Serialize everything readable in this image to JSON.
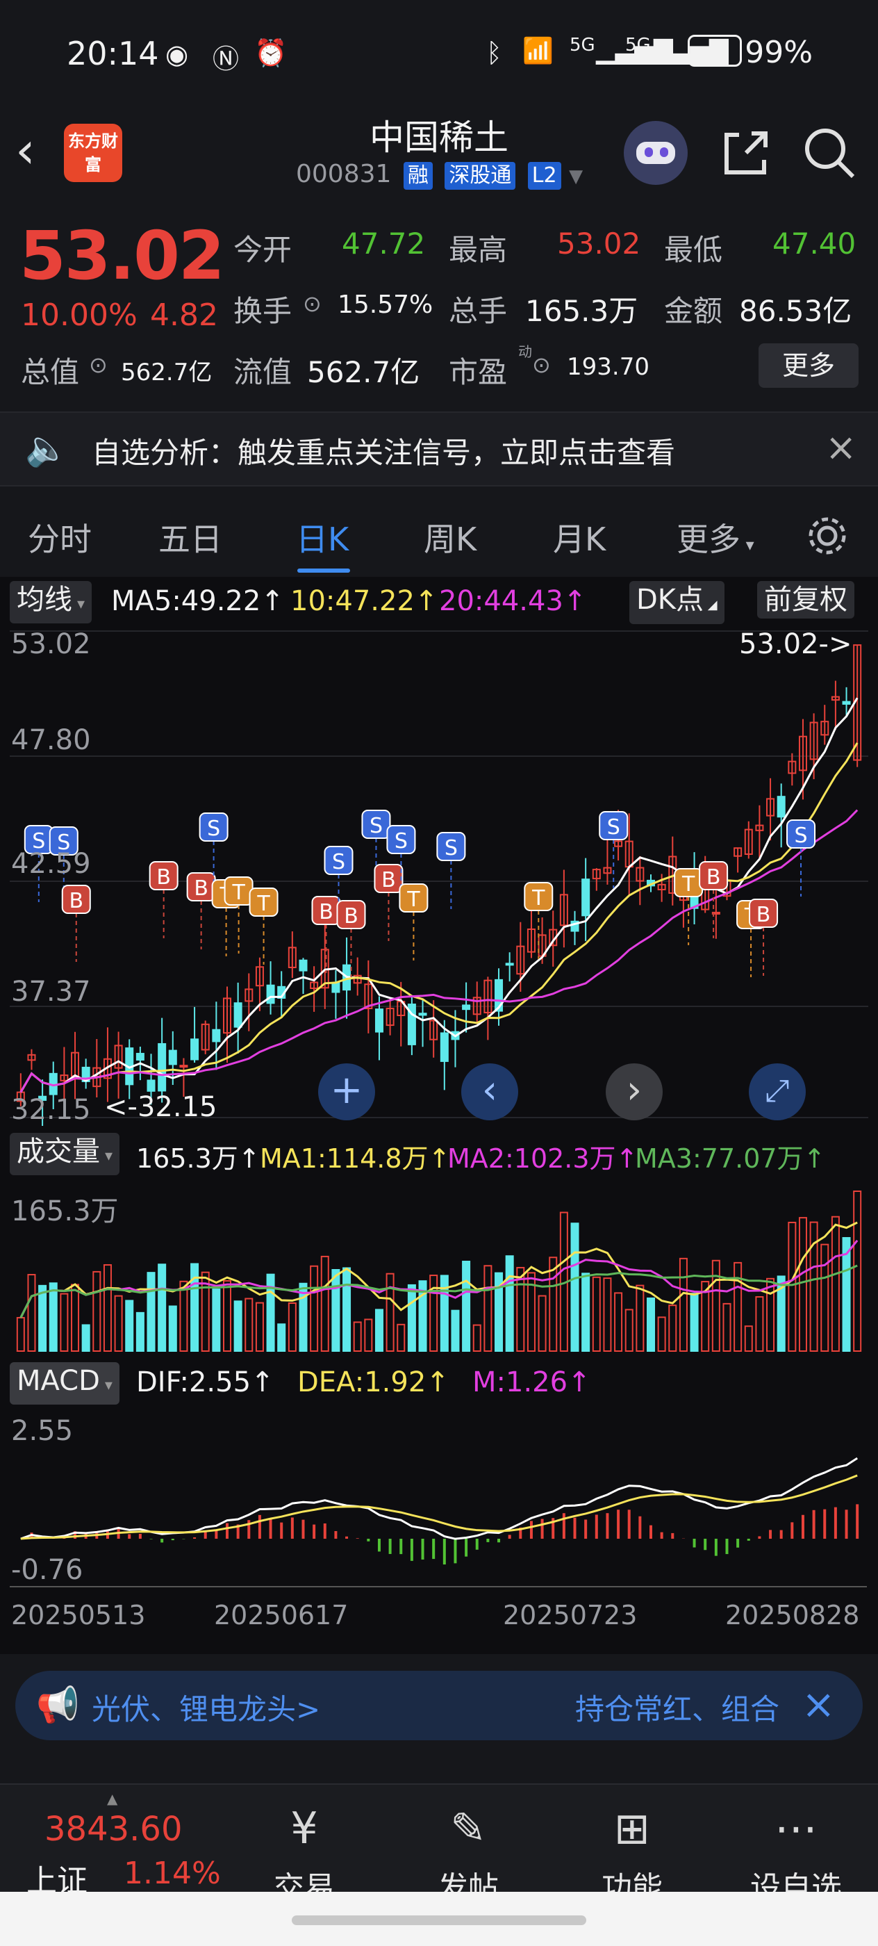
{
  "status_bar": {
    "time": "20:14",
    "battery": "99%",
    "net1": "5G",
    "net2": "5G"
  },
  "header": {
    "logo_text": "东方财富",
    "title": "中国稀土",
    "code": "000831",
    "tags": [
      "融",
      "深股通",
      "L2"
    ]
  },
  "quote": {
    "price": "53.02",
    "pct": "10.00%",
    "change": "4.82",
    "fields": [
      {
        "label": "今开",
        "value": "47.72",
        "color": "#52c234"
      },
      {
        "label": "最高",
        "value": "53.02",
        "color": "#e8423a"
      },
      {
        "label": "最低",
        "value": "47.40",
        "color": "#52c234"
      },
      {
        "label": "换手",
        "value": "15.57%",
        "color": "#f2f2f2"
      },
      {
        "label": "总手",
        "value": "165.3万",
        "color": "#f2f2f2"
      },
      {
        "label": "金额",
        "value": "86.53亿",
        "color": "#f2f2f2"
      },
      {
        "label": "总值",
        "value": "562.7亿",
        "color": "#f2f2f2"
      },
      {
        "label": "流值",
        "value": "562.7亿",
        "color": "#f2f2f2"
      },
      {
        "label": "市盈",
        "value": "193.70",
        "color": "#f2f2f2",
        "sup": "动"
      }
    ],
    "more_label": "更多"
  },
  "alert": {
    "text": "自选分析：触发重点关注信号，立即点击查看"
  },
  "tabs": [
    "分时",
    "五日",
    "日K",
    "周K",
    "月K",
    "更多"
  ],
  "active_tab": "日K",
  "kline": {
    "selector": "均线",
    "ma5": "MA5:49.22↑",
    "ma10": "10:47.22↑",
    "ma20": "20:44.43↑",
    "dk": "DK点",
    "adjust": "前复权",
    "y_labels": [
      "53.02",
      "47.80",
      "42.59",
      "37.37",
      "32.15"
    ],
    "max_label": "53.02->",
    "min_label": "<-32.15"
  },
  "volume": {
    "selector": "成交量",
    "v": "165.3万↑",
    "ma1": "MA1:114.8万↑",
    "ma2": "MA2:102.3万↑",
    "ma3": "MA3:77.07万↑",
    "y_label": "165.3万"
  },
  "macd": {
    "selector": "MACD",
    "dif": "DIF:2.55↑",
    "dea": "DEA:1.92↑",
    "m": "M:1.26↑",
    "y_top": "2.55",
    "y_bottom": "-0.76"
  },
  "dates": [
    "20250513",
    "20250617",
    "20250723",
    "20250828"
  ],
  "ticker": {
    "left": "光伏、锂电龙头>",
    "right": "持仓常红、组合"
  },
  "nav": {
    "index_value": "3843.60",
    "index_name": "上证",
    "index_pct": "1.14%",
    "items": [
      "交易",
      "发帖",
      "功能",
      "设自选"
    ]
  },
  "colors": {
    "up": "#e8423a",
    "down": "#5ee8ea",
    "ma5": "#ffffff",
    "ma10": "#f5e35a",
    "ma20": "#e23fe0",
    "accent": "#3f8cf0"
  }
}
